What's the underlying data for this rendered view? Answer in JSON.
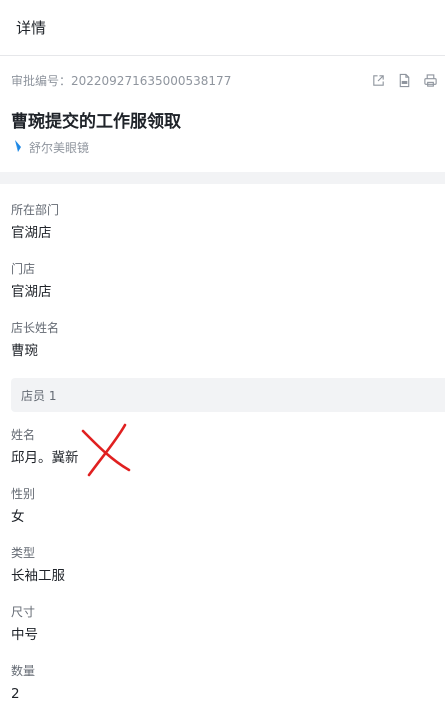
{
  "header": {
    "title": "详情"
  },
  "meta": {
    "approval_no": "审批编号：202209271635000538177",
    "icons": [
      "share-icon",
      "pdf-icon",
      "print-icon"
    ]
  },
  "form": {
    "title": "曹琬提交的工作服领取",
    "company": "舒尔美眼镜"
  },
  "fields": [
    {
      "label": "所在部门",
      "value": "官湖店"
    },
    {
      "label": "门店",
      "value": "官湖店"
    },
    {
      "label": "店长姓名",
      "value": "曹琬"
    }
  ],
  "group": {
    "title": "店员 1",
    "fields": [
      {
        "label": "姓名",
        "value": "邱月。冀新"
      },
      {
        "label": "性别",
        "value": "女"
      },
      {
        "label": "类型",
        "value": "长袖工服"
      },
      {
        "label": "尺寸",
        "value": "中号"
      },
      {
        "label": "数量",
        "value": "2"
      }
    ]
  },
  "colors": {
    "accent": "#1e88e5",
    "annotation": "#e02020",
    "band": "#f2f3f5"
  }
}
